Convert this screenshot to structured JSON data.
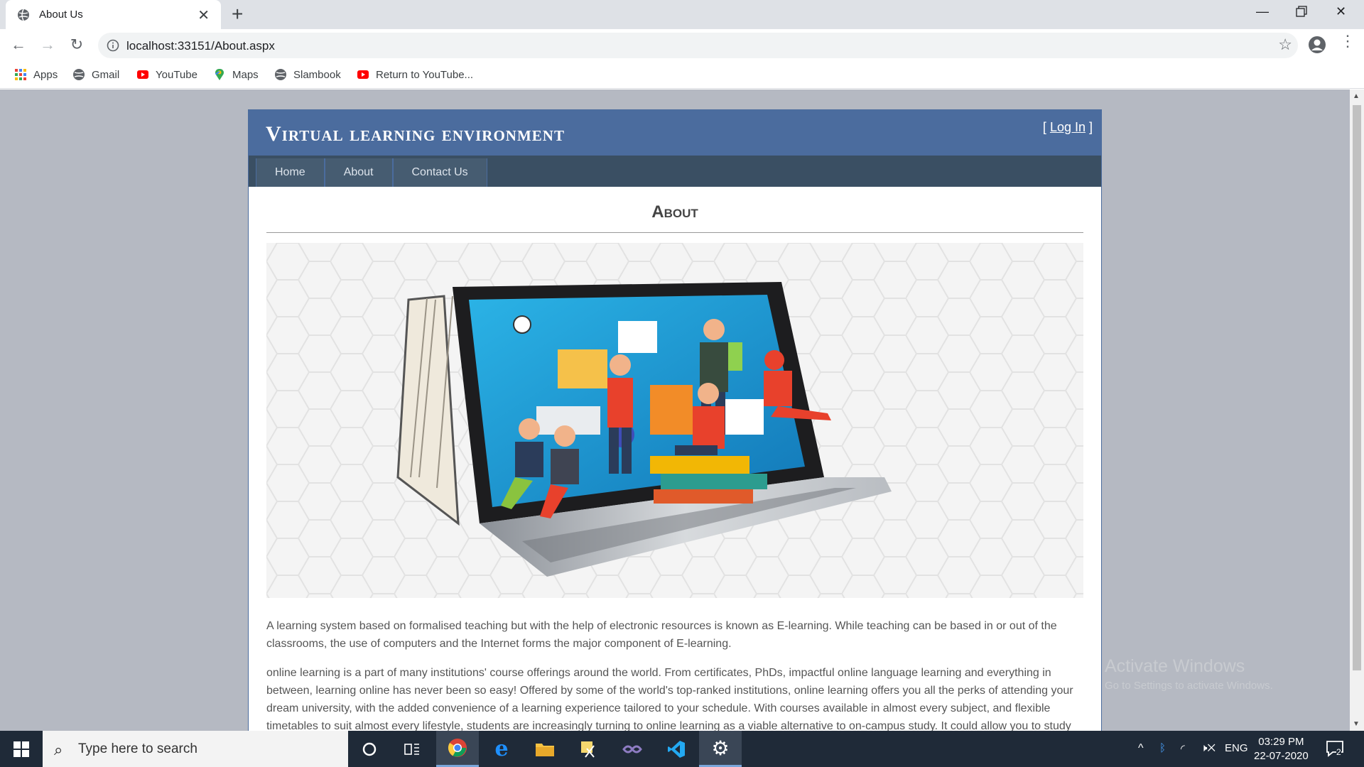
{
  "browser": {
    "tab_title": "About Us",
    "url": "localhost:33151/About.aspx",
    "bookmarks": [
      "Apps",
      "Gmail",
      "YouTube",
      "Maps",
      "Slambook",
      "Return to YouTube..."
    ]
  },
  "site": {
    "title": "Virtual learning environment",
    "login_open": "[ ",
    "login_label": "Log In",
    "login_close": " ]",
    "nav": [
      "Home",
      "About",
      "Contact Us"
    ],
    "heading": "About",
    "paragraphs": [
      "A learning system based on formalised teaching but with the help of electronic resources is known as E-learning. While teaching can be based in or out of the classrooms, the use of computers and the Internet forms the major component of E-learning.",
      "online learning is a part of many institutions' course offerings around the world. From certificates, PhDs, impactful online language learning and everything in between, learning online has never been so easy! Offered by some of the world's top-ranked institutions, online learning offers you all the perks of attending your dream university, with the added convenience of a learning experience tailored to your schedule. With courses available in almost every subject, and flexible timetables to suit almost every lifestyle, students are increasingly turning to online learning as a viable alternative to on-campus study. It could allow you to study"
    ]
  },
  "watermark": {
    "line1": "Activate Windows",
    "line2": "Go to Settings to activate Windows."
  },
  "taskbar": {
    "search_placeholder": "Type here to search",
    "language": "ENG",
    "time": "03:29 PM",
    "date": "22-07-2020",
    "notification_count": "2"
  }
}
